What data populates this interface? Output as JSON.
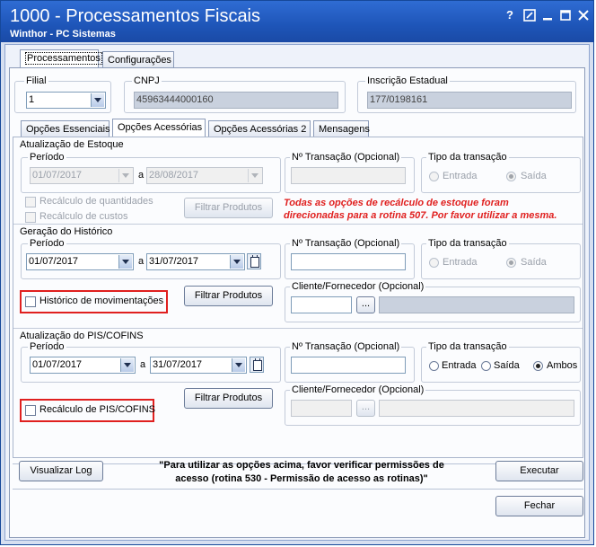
{
  "window": {
    "title": "1000 - Processamentos Fiscais",
    "subtitle": "Winthor - PC Sistemas",
    "controls": [
      "?",
      "edit",
      "minimize",
      "maximize",
      "close"
    ]
  },
  "top_tabs": [
    "Processamentos",
    "Configurações"
  ],
  "filial": {
    "label": "Filial",
    "value": "1"
  },
  "cnpj": {
    "label": "CNPJ",
    "value": "45963444000160"
  },
  "inscricao": {
    "label": "Inscrição Estadual",
    "value": "177/0198161"
  },
  "sub_tabs": [
    "Opções Essenciais",
    "Opções Acessórias",
    "Opções Acessórias 2",
    "Mensagens"
  ],
  "estoque": {
    "title": "Atualização de Estoque",
    "periodo_label": "Período",
    "date_from": "01/07/2017",
    "a_label": "a",
    "date_to": "28/08/2017",
    "transacao_label": "Nº Transação (Opcional)",
    "tipo_label": "Tipo da transação",
    "entrada": "Entrada",
    "saida": "Saída",
    "recalculo_qtd": "Recálculo de quantidades",
    "recalculo_custos": "Recálculo de custos",
    "filtrar": "Filtrar Produtos",
    "note_line1": "Todas as opções de recálculo de estoque foram",
    "note_line2": "direcionadas para a rotina 507. Por favor utilizar a mesma."
  },
  "historico": {
    "title": "Geração do Histórico",
    "periodo_label": "Período",
    "date_from": "01/07/2017",
    "a_label": "a",
    "date_to": "31/07/2017",
    "transacao_label": "Nº Transação (Opcional)",
    "tipo_label": "Tipo da transação",
    "entrada": "Entrada",
    "saida": "Saída",
    "historico_mov": "Histórico de movimentações",
    "filtrar": "Filtrar Produtos",
    "cliente_label": "Cliente/Fornecedor (Opcional)",
    "ellipsis": "..."
  },
  "pis": {
    "title": "Atualização do PIS/COFINS",
    "periodo_label": "Período",
    "date_from": "01/07/2017",
    "a_label": "a",
    "date_to": "31/07/2017",
    "transacao_label": "Nº Transação (Opcional)",
    "tipo_label": "Tipo da transação",
    "entrada": "Entrada",
    "saida": "Saída",
    "ambos": "Ambos",
    "recalculo_pis": "Recálculo de PIS/COFINS",
    "filtrar": "Filtrar Produtos",
    "cliente_label": "Cliente/Fornecedor (Opcional)",
    "ellipsis": "..."
  },
  "bottom": {
    "visualizar_log": "Visualizar Log",
    "message_line1": "\"Para utilizar as opções acima, favor verificar permissões de",
    "message_line2": "acesso (rotina 530 - Permissão de acesso as rotinas)\"",
    "executar": "Executar",
    "fechar": "Fechar"
  }
}
